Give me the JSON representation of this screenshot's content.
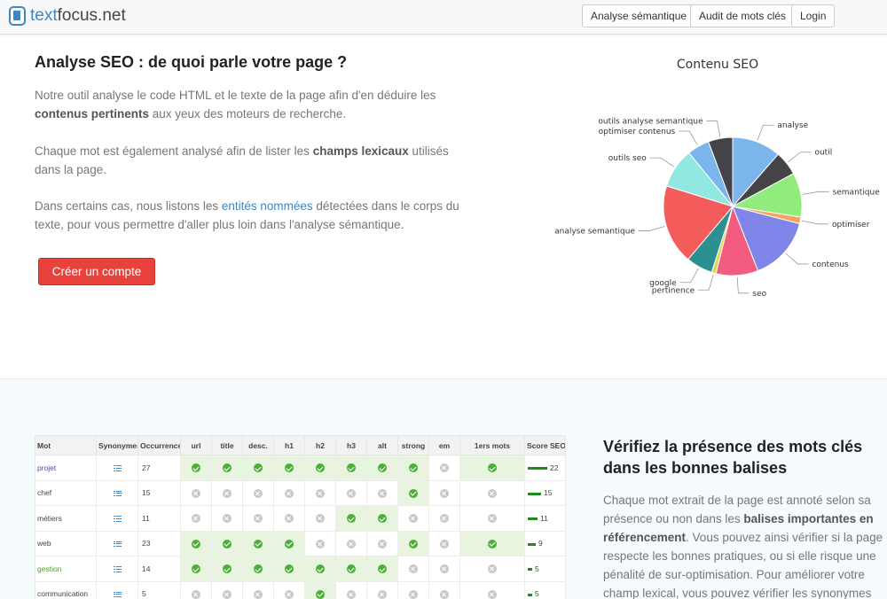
{
  "header": {
    "brand_a": "text",
    "brand_b": "focus.net",
    "nav": [
      "Analyse sémantique",
      "Audit de mots clés",
      "Login"
    ]
  },
  "intro": {
    "title": "Analyse SEO : de quoi parle votre page ?",
    "p1_a": "Notre outil analyse le code HTML et le texte de la page afin d'en déduire les",
    "p1_b": "contenus pertinents",
    "p1_c": " aux yeux des moteurs de recherche.",
    "p2_a": "Chaque mot est également analysé afin de lister les ",
    "p2_b": "champs lexicaux",
    "p2_c": " utilisés dans la page.",
    "p3_a": "Dans certains cas, nous listons les ",
    "p3_link": "entités nommées",
    "p3_c": " détectées dans le corps du texte, pour vous permettre d'aller plus loin dans l'analyse sémantique.",
    "cta": "Créer un compte"
  },
  "chart_data": {
    "type": "pie",
    "title": "Contenu SEO",
    "slices": [
      {
        "label": "analyse",
        "value": 11,
        "color": "#7cb5ec"
      },
      {
        "label": "outil",
        "value": 5.5,
        "color": "#434348"
      },
      {
        "label": "semantique",
        "value": 10,
        "color": "#90ed7d"
      },
      {
        "label": "optimiser",
        "value": 1.5,
        "color": "#f7a35c"
      },
      {
        "label": "contenus",
        "value": 14.5,
        "color": "#8085e9"
      },
      {
        "label": "seo",
        "value": 9.5,
        "color": "#f15c80"
      },
      {
        "label": "pertinence",
        "value": 1,
        "color": "#e4d354"
      },
      {
        "label": "google",
        "value": 6,
        "color": "#2b908f"
      },
      {
        "label": "analyse semantique",
        "value": 18,
        "color": "#f45b5b"
      },
      {
        "label": "outils seo",
        "value": 9,
        "color": "#91e8e1"
      },
      {
        "label": "optimiser contenus",
        "value": 5,
        "color": "#7cb5ec"
      },
      {
        "label": "outils analyse semantique",
        "value": 5.5,
        "color": "#434348"
      }
    ]
  },
  "keywords": {
    "title": "Vérifiez la présence des mots clés dans les bonnes balises",
    "p_a": "Chaque mot extrait de la page est annoté selon sa présence ou non dans les ",
    "p_b": "balises importantes en référencement",
    "p_c": ". Vous pouvez ainsi vérifier si la page respecte les bonnes pratiques, ou si elle risque une pénalité de sur-optimisation. Pour améliorer votre champ lexical, vous pouvez vérifier les synonymes de",
    "table": {
      "headers": [
        "Mot",
        "Synonymes",
        "Occurrence",
        "url",
        "title",
        "desc.",
        "h1",
        "h2",
        "h3",
        "alt",
        "strong",
        "em",
        "1ers mots",
        "Score SEO"
      ],
      "rows": [
        {
          "mot": "projet",
          "style": "link",
          "occ": "27",
          "tags": [
            1,
            1,
            1,
            1,
            1,
            1,
            1,
            1,
            0,
            1
          ],
          "score": 22
        },
        {
          "mot": "chef",
          "style": "",
          "occ": "15",
          "tags": [
            0,
            0,
            0,
            0,
            0,
            0,
            0,
            1,
            0,
            0
          ],
          "score": 15
        },
        {
          "mot": "métiers",
          "style": "",
          "occ": "11",
          "tags": [
            0,
            0,
            0,
            0,
            0,
            1,
            1,
            0,
            0,
            0
          ],
          "score": 11
        },
        {
          "mot": "web",
          "style": "",
          "occ": "23",
          "tags": [
            1,
            1,
            1,
            1,
            0,
            0,
            0,
            1,
            0,
            1
          ],
          "score": 9
        },
        {
          "mot": "gestion",
          "style": "green",
          "occ": "14",
          "tags": [
            1,
            1,
            1,
            1,
            1,
            1,
            1,
            0,
            0,
            0
          ],
          "score": 5
        },
        {
          "mot": "communication",
          "style": "",
          "occ": "5",
          "tags": [
            0,
            0,
            0,
            0,
            1,
            0,
            0,
            0,
            0,
            0
          ],
          "score": 5
        }
      ]
    }
  }
}
